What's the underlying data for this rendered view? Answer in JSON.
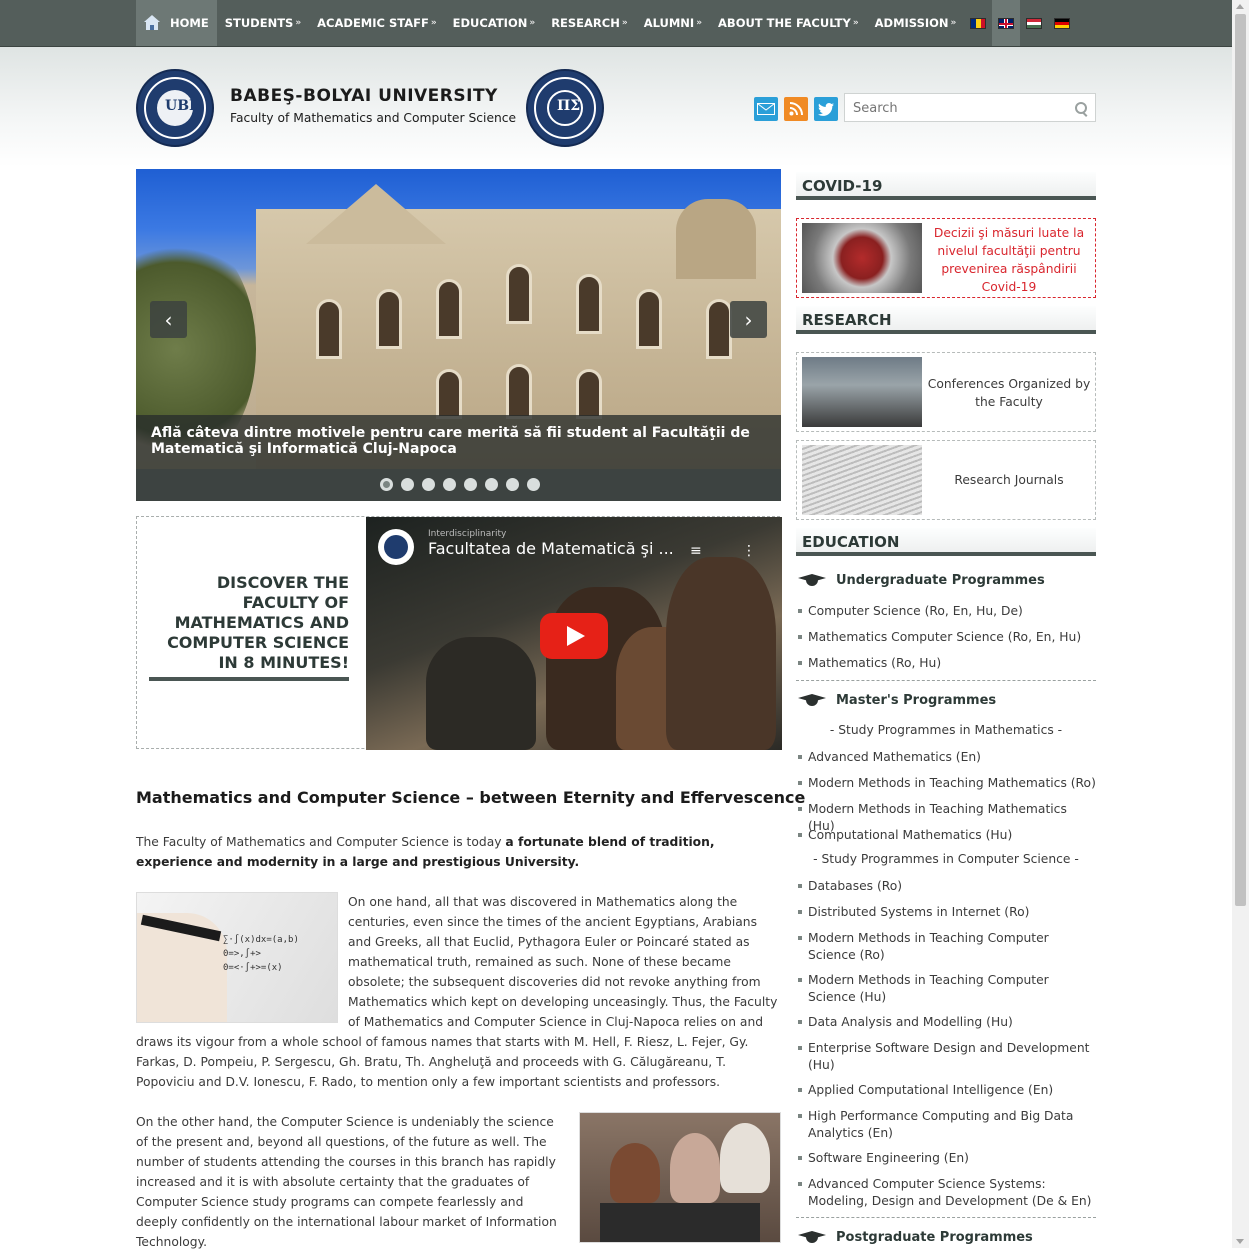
{
  "nav": {
    "items": [
      {
        "label": "HOME",
        "arrow": ""
      },
      {
        "label": "STUDENTS",
        "arrow": "»"
      },
      {
        "label": "ACADEMIC STAFF",
        "arrow": "»"
      },
      {
        "label": "EDUCATION",
        "arrow": "»"
      },
      {
        "label": "RESEARCH",
        "arrow": "»"
      },
      {
        "label": "ALUMNI",
        "arrow": "»"
      },
      {
        "label": "ABOUT THE FACULTY",
        "arrow": "»"
      },
      {
        "label": "ADMISSION",
        "arrow": "»"
      }
    ],
    "flags": [
      {
        "name": "romanian-flag",
        "colors": [
          "#002b7f",
          "#fcd116",
          "#ce1126"
        ],
        "vertical": true
      },
      {
        "name": "english-flag",
        "colors": [
          "#012169",
          "#c8102e",
          "#012169"
        ],
        "vertical": false
      },
      {
        "name": "hungarian-flag",
        "colors": [
          "#ce2939",
          "#ffffff",
          "#477050"
        ],
        "vertical": false
      },
      {
        "name": "german-flag",
        "colors": [
          "#000000",
          "#dd0000",
          "#ffce00"
        ],
        "vertical": false
      }
    ]
  },
  "header": {
    "university": "BABEŞ-BOLYAI UNIVERSITY",
    "faculty": "Faculty of Mathematics and Computer Science",
    "search_placeholder": "Search"
  },
  "slider": {
    "caption": "Află câteva dintre motivele pentru care merită să fii student al Facultăţii de Matematică şi Informatică Cluj-Napoca",
    "dot_count": 8,
    "active_dot": 1
  },
  "discover": {
    "text": "DISCOVER THE FACULTY OF MATHEMATICS AND COMPUTER SCIENCE IN 8 MINUTES!",
    "video_title": "Facultatea de Matematică şi ...",
    "video_channel": "Interdisciplinarity"
  },
  "article": {
    "title": "Mathematics and Computer Science – between Eternity and Effervescence",
    "intro_plain": "The Faculty of Mathematics and Computer Science is today ",
    "intro_bold": "a fortunate blend of tradition, experience and modernity in a large and prestigious University.",
    "p1": "On one hand, all that was discovered in Mathematics along the centuries, even since the times of the ancient Egyptians, Arabians and Greeks, all that Euclid, Pythagora Euler or Poincaré stated as mathematical truth, remained as such. None of these became obsolete; the subsequent discoveries did not revoke anything from Mathematics which kept on developing unceasingly. Thus, the Faculty of Mathematics and Computer Science in Cluj-Napoca relies on and draws its vigour from a whole school of famous names that starts with M. Hell, F. Riesz, L. Fejer, Gy. Farkas, D. Pompeiu, P. Sergescu, Gh. Bratu, Th. Angheluţă and proceeds with G. Călugăreanu, T. Popoviciu and D.V. Ionescu, F. Rado, to mention only a few important scientists and professors.",
    "p2": "On the other hand, the Computer Science is undeniably the science of the present and, beyond all questions, of the future as well. The number of students attending the courses in this branch has rapidly increased and it is with absolute certainty that the graduates of Computer Science study programs can compete fearlessly and deeply confidently on the international labour market of Information Technology."
  },
  "sidebar": {
    "covid_heading": "COVID-19",
    "covid_text": "Decizii şi măsuri luate la nivelul facultăţii pentru prevenirea răspândirii Covid-19",
    "research_heading": "RESEARCH",
    "research_items": [
      "Conferences Organized by the Faculty",
      "Research Journals"
    ],
    "education_heading": "EDUCATION",
    "undergrad": {
      "title": "Undergraduate Programmes",
      "items": [
        "Computer Science (Ro, En, Hu, De)",
        "Mathematics Computer Science (Ro, En, Hu)",
        "Mathematics (Ro, Hu)"
      ]
    },
    "masters": {
      "title": "Master's Programmes",
      "math_sub": "- Study Programmes in Mathematics -",
      "math_items": [
        "Advanced Mathematics (En)",
        "Modern Methods in Teaching Mathematics (Ro)",
        "Modern Methods in Teaching Mathematics (Hu)",
        "Computational Mathematics (Hu)"
      ],
      "cs_sub": "- Study Programmes in Computer Science -",
      "cs_items": [
        "Databases (Ro)",
        "Distributed Systems in Internet (Ro)",
        "Modern Methods in Teaching Computer Science (Ro)",
        "Modern Methods in Teaching Computer Science (Hu)",
        "Data Analysis and Modelling (Hu)",
        "Enterprise Software Design and Development (Hu)",
        "Applied Computational Intelligence (En)",
        "High Performance Computing and Big Data Analytics (En)",
        "Software Engineering (En)",
        "Advanced Computer Science Systems: Modeling, Design and Development (De & En)"
      ]
    },
    "postgrad": {
      "title": "Postgraduate Programmes"
    }
  }
}
